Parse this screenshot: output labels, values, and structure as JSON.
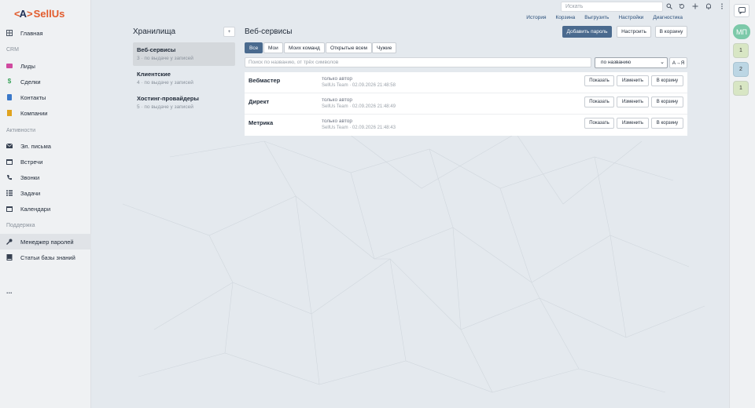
{
  "logo": {
    "left": "<",
    "mark": "A",
    "right": ">",
    "word": "SellUs"
  },
  "sidebar": {
    "home": {
      "label": "Главная",
      "icon": "grid-icon"
    },
    "sections": {
      "crm": "CRM",
      "activities": "Активности",
      "support": "Поддержка"
    },
    "crm_items": [
      {
        "label": "Лиды",
        "icon": "leads-icon",
        "color": "#d04aa0"
      },
      {
        "label": "Сделки",
        "icon": "dollar-icon",
        "color": "#3aa35a"
      },
      {
        "label": "Контакты",
        "icon": "contacts-icon",
        "color": "#3a78c9"
      },
      {
        "label": "Компании",
        "icon": "company-icon",
        "color": "#e0a31f"
      }
    ],
    "activity_items": [
      {
        "label": "Эл. письма",
        "icon": "mail-icon"
      },
      {
        "label": "Встречи",
        "icon": "calendar-icon"
      },
      {
        "label": "Звонки",
        "icon": "phone-icon"
      },
      {
        "label": "Задачи",
        "icon": "tasks-icon"
      },
      {
        "label": "Календари",
        "icon": "calendar-icon"
      }
    ],
    "support_items": [
      {
        "label": "Менеджер паролей",
        "icon": "key-icon",
        "active": true
      },
      {
        "label": "Статьи базы знаний",
        "icon": "book-icon"
      }
    ],
    "more": "..."
  },
  "topbar": {
    "search_placeholder": "Искать",
    "links": [
      "История",
      "Корзина",
      "Выгрузить",
      "Настройки",
      "Диагностика"
    ]
  },
  "rail": {
    "avatar": "МП",
    "badges": [
      "1",
      "2",
      "1"
    ]
  },
  "storages": {
    "title": "Хранилища",
    "add_label": "+",
    "items": [
      {
        "name": "Веб-сервисы",
        "sub": "3 · по выдаче у записей",
        "active": true
      },
      {
        "name": "Клиентские",
        "sub": "4 · по выдаче у записей"
      },
      {
        "name": "Хостинг-провайдеры",
        "sub": "5 · по выдаче у записей"
      }
    ]
  },
  "main": {
    "title": "Веб-сервисы",
    "actions": {
      "add": "Добавить пароль",
      "configure": "Настроить",
      "trash": "В корзину"
    },
    "filters": [
      "Все",
      "Мои",
      "Моих команд",
      "Открытые всем",
      "Чужие"
    ],
    "active_filter": "Все",
    "search_placeholder": "Поиск по названию, от трёх символов",
    "sort_select": "по названию",
    "sort_dir": "А→Я",
    "row_buttons": {
      "show": "Показать",
      "edit": "Изменить",
      "trash": "В корзину"
    },
    "rows": [
      {
        "name": "Вебмастер",
        "access": "только автор",
        "meta": "SellUs Team · 02.09.2026 21:48:58"
      },
      {
        "name": "Директ",
        "access": "только автор",
        "meta": "SellUs Team · 02.09.2026 21:48:49"
      },
      {
        "name": "Метрика",
        "access": "только автор",
        "meta": "SellUs Team · 02.09.2026 21:48:43"
      }
    ]
  }
}
